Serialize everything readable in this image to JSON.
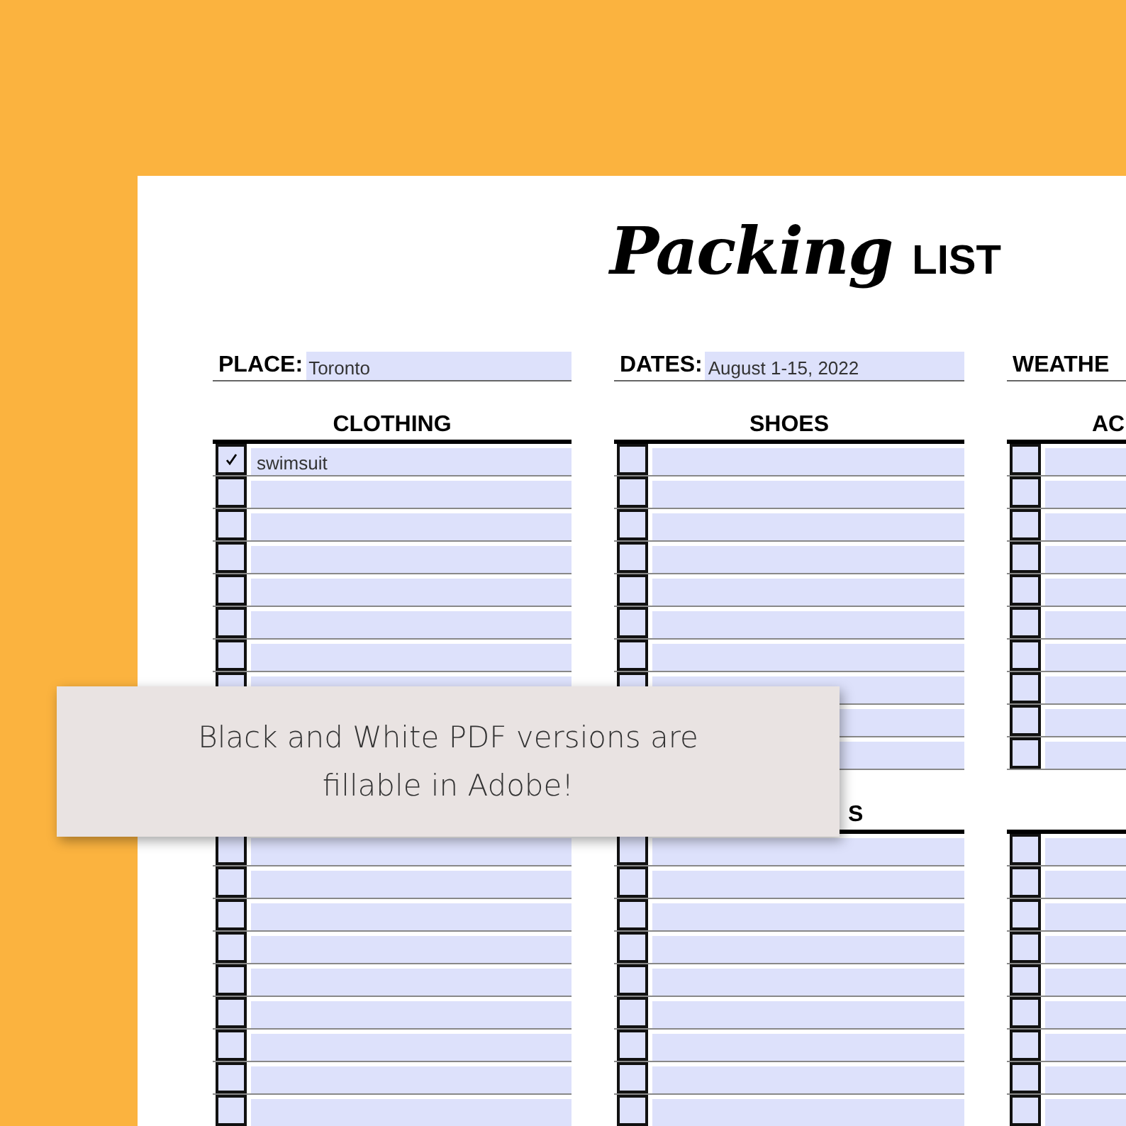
{
  "title": {
    "script": "Packing",
    "caps": "LIST"
  },
  "fields": [
    {
      "label": "PLACE:",
      "value": "Toronto"
    },
    {
      "label": "DATES:",
      "value": "August 1-15, 2022"
    },
    {
      "label": "WEATHE"
    }
  ],
  "sections": [
    {
      "columns": [
        {
          "heading": "CLOTHING",
          "items": [
            {
              "checked": true,
              "value": "swimsuit"
            },
            {
              "checked": false
            },
            {
              "checked": false
            },
            {
              "checked": false
            },
            {
              "checked": false
            },
            {
              "checked": false
            },
            {
              "checked": false
            },
            {
              "checked": false
            }
          ]
        },
        {
          "heading": "SHOES",
          "items": [
            {
              "kind": "row",
              "checked": false
            },
            {
              "kind": "row",
              "checked": false
            },
            {
              "kind": "row",
              "checked": false
            },
            {
              "kind": "row",
              "checked": false
            },
            {
              "kind": "row",
              "checked": false
            },
            {
              "kind": "row",
              "checked": false
            },
            {
              "kind": "row",
              "checked": false
            },
            {
              "kind": "row",
              "checked": false
            },
            {
              "kind": "field-only"
            },
            {
              "kind": "field-only"
            }
          ]
        },
        {
          "heading": "AC",
          "items": [
            {
              "checked": false
            },
            {
              "checked": false
            },
            {
              "checked": false
            },
            {
              "checked": false
            },
            {
              "checked": false
            },
            {
              "checked": false
            },
            {
              "checked": false
            },
            {
              "checked": false
            },
            {
              "checked": false
            },
            {
              "checked": false
            }
          ]
        }
      ]
    },
    {
      "columns": [
        {
          "items": [
            {
              "checked": false
            },
            {
              "checked": false
            },
            {
              "checked": false
            },
            {
              "checked": false
            },
            {
              "checked": false
            },
            {
              "checked": false
            },
            {
              "checked": false
            },
            {
              "checked": false
            },
            {
              "checked": false
            }
          ]
        },
        {
          "heading": "S",
          "items": [
            {
              "checked": false
            },
            {
              "checked": false
            },
            {
              "checked": false
            },
            {
              "checked": false
            },
            {
              "checked": false
            },
            {
              "checked": false
            },
            {
              "checked": false
            },
            {
              "checked": false
            },
            {
              "checked": false
            }
          ]
        },
        {
          "items": [
            {
              "checked": false
            },
            {
              "checked": false
            },
            {
              "checked": false
            },
            {
              "checked": false
            },
            {
              "checked": false
            },
            {
              "checked": false
            },
            {
              "checked": false
            },
            {
              "checked": false
            },
            {
              "checked": false
            }
          ]
        }
      ]
    }
  ],
  "banner": {
    "text": "Black and White PDF versions are fillable in Adobe!"
  }
}
